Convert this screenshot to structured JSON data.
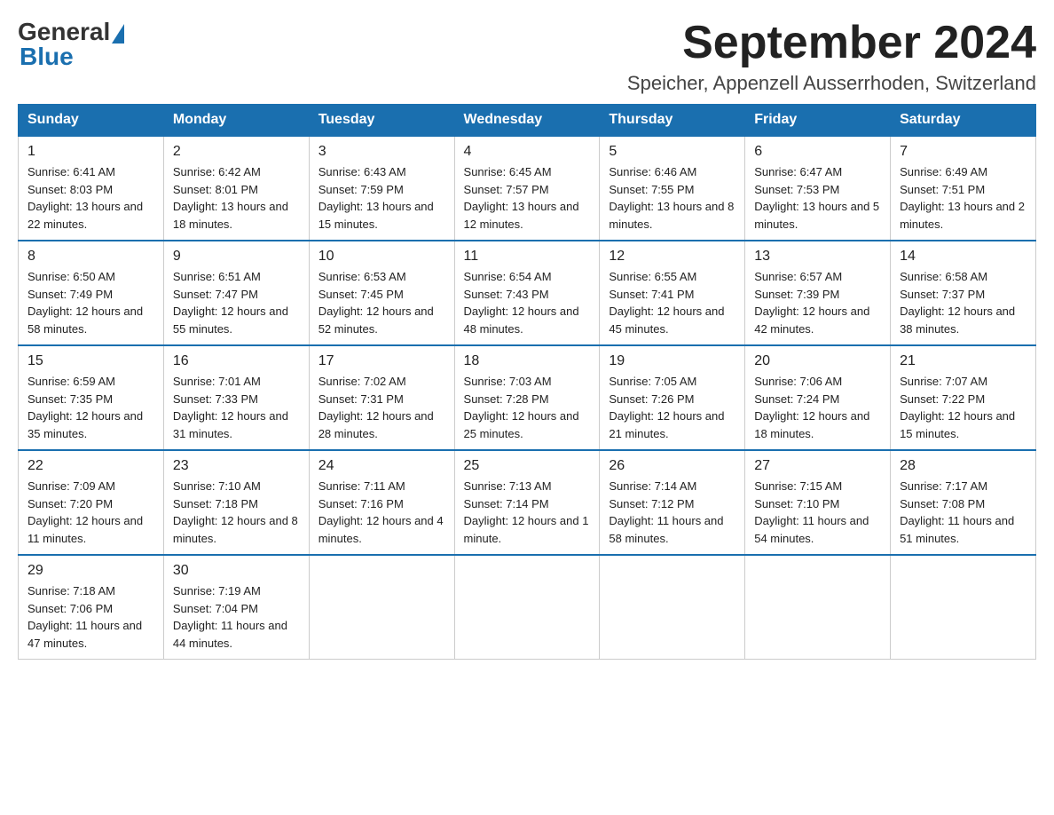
{
  "header": {
    "logo": {
      "general": "General",
      "blue": "Blue"
    },
    "title": "September 2024",
    "location": "Speicher, Appenzell Ausserrhoden, Switzerland"
  },
  "days_of_week": [
    "Sunday",
    "Monday",
    "Tuesday",
    "Wednesday",
    "Thursday",
    "Friday",
    "Saturday"
  ],
  "weeks": [
    [
      {
        "day": "1",
        "sunrise": "Sunrise: 6:41 AM",
        "sunset": "Sunset: 8:03 PM",
        "daylight": "Daylight: 13 hours and 22 minutes."
      },
      {
        "day": "2",
        "sunrise": "Sunrise: 6:42 AM",
        "sunset": "Sunset: 8:01 PM",
        "daylight": "Daylight: 13 hours and 18 minutes."
      },
      {
        "day": "3",
        "sunrise": "Sunrise: 6:43 AM",
        "sunset": "Sunset: 7:59 PM",
        "daylight": "Daylight: 13 hours and 15 minutes."
      },
      {
        "day": "4",
        "sunrise": "Sunrise: 6:45 AM",
        "sunset": "Sunset: 7:57 PM",
        "daylight": "Daylight: 13 hours and 12 minutes."
      },
      {
        "day": "5",
        "sunrise": "Sunrise: 6:46 AM",
        "sunset": "Sunset: 7:55 PM",
        "daylight": "Daylight: 13 hours and 8 minutes."
      },
      {
        "day": "6",
        "sunrise": "Sunrise: 6:47 AM",
        "sunset": "Sunset: 7:53 PM",
        "daylight": "Daylight: 13 hours and 5 minutes."
      },
      {
        "day": "7",
        "sunrise": "Sunrise: 6:49 AM",
        "sunset": "Sunset: 7:51 PM",
        "daylight": "Daylight: 13 hours and 2 minutes."
      }
    ],
    [
      {
        "day": "8",
        "sunrise": "Sunrise: 6:50 AM",
        "sunset": "Sunset: 7:49 PM",
        "daylight": "Daylight: 12 hours and 58 minutes."
      },
      {
        "day": "9",
        "sunrise": "Sunrise: 6:51 AM",
        "sunset": "Sunset: 7:47 PM",
        "daylight": "Daylight: 12 hours and 55 minutes."
      },
      {
        "day": "10",
        "sunrise": "Sunrise: 6:53 AM",
        "sunset": "Sunset: 7:45 PM",
        "daylight": "Daylight: 12 hours and 52 minutes."
      },
      {
        "day": "11",
        "sunrise": "Sunrise: 6:54 AM",
        "sunset": "Sunset: 7:43 PM",
        "daylight": "Daylight: 12 hours and 48 minutes."
      },
      {
        "day": "12",
        "sunrise": "Sunrise: 6:55 AM",
        "sunset": "Sunset: 7:41 PM",
        "daylight": "Daylight: 12 hours and 45 minutes."
      },
      {
        "day": "13",
        "sunrise": "Sunrise: 6:57 AM",
        "sunset": "Sunset: 7:39 PM",
        "daylight": "Daylight: 12 hours and 42 minutes."
      },
      {
        "day": "14",
        "sunrise": "Sunrise: 6:58 AM",
        "sunset": "Sunset: 7:37 PM",
        "daylight": "Daylight: 12 hours and 38 minutes."
      }
    ],
    [
      {
        "day": "15",
        "sunrise": "Sunrise: 6:59 AM",
        "sunset": "Sunset: 7:35 PM",
        "daylight": "Daylight: 12 hours and 35 minutes."
      },
      {
        "day": "16",
        "sunrise": "Sunrise: 7:01 AM",
        "sunset": "Sunset: 7:33 PM",
        "daylight": "Daylight: 12 hours and 31 minutes."
      },
      {
        "day": "17",
        "sunrise": "Sunrise: 7:02 AM",
        "sunset": "Sunset: 7:31 PM",
        "daylight": "Daylight: 12 hours and 28 minutes."
      },
      {
        "day": "18",
        "sunrise": "Sunrise: 7:03 AM",
        "sunset": "Sunset: 7:28 PM",
        "daylight": "Daylight: 12 hours and 25 minutes."
      },
      {
        "day": "19",
        "sunrise": "Sunrise: 7:05 AM",
        "sunset": "Sunset: 7:26 PM",
        "daylight": "Daylight: 12 hours and 21 minutes."
      },
      {
        "day": "20",
        "sunrise": "Sunrise: 7:06 AM",
        "sunset": "Sunset: 7:24 PM",
        "daylight": "Daylight: 12 hours and 18 minutes."
      },
      {
        "day": "21",
        "sunrise": "Sunrise: 7:07 AM",
        "sunset": "Sunset: 7:22 PM",
        "daylight": "Daylight: 12 hours and 15 minutes."
      }
    ],
    [
      {
        "day": "22",
        "sunrise": "Sunrise: 7:09 AM",
        "sunset": "Sunset: 7:20 PM",
        "daylight": "Daylight: 12 hours and 11 minutes."
      },
      {
        "day": "23",
        "sunrise": "Sunrise: 7:10 AM",
        "sunset": "Sunset: 7:18 PM",
        "daylight": "Daylight: 12 hours and 8 minutes."
      },
      {
        "day": "24",
        "sunrise": "Sunrise: 7:11 AM",
        "sunset": "Sunset: 7:16 PM",
        "daylight": "Daylight: 12 hours and 4 minutes."
      },
      {
        "day": "25",
        "sunrise": "Sunrise: 7:13 AM",
        "sunset": "Sunset: 7:14 PM",
        "daylight": "Daylight: 12 hours and 1 minute."
      },
      {
        "day": "26",
        "sunrise": "Sunrise: 7:14 AM",
        "sunset": "Sunset: 7:12 PM",
        "daylight": "Daylight: 11 hours and 58 minutes."
      },
      {
        "day": "27",
        "sunrise": "Sunrise: 7:15 AM",
        "sunset": "Sunset: 7:10 PM",
        "daylight": "Daylight: 11 hours and 54 minutes."
      },
      {
        "day": "28",
        "sunrise": "Sunrise: 7:17 AM",
        "sunset": "Sunset: 7:08 PM",
        "daylight": "Daylight: 11 hours and 51 minutes."
      }
    ],
    [
      {
        "day": "29",
        "sunrise": "Sunrise: 7:18 AM",
        "sunset": "Sunset: 7:06 PM",
        "daylight": "Daylight: 11 hours and 47 minutes."
      },
      {
        "day": "30",
        "sunrise": "Sunrise: 7:19 AM",
        "sunset": "Sunset: 7:04 PM",
        "daylight": "Daylight: 11 hours and 44 minutes."
      },
      null,
      null,
      null,
      null,
      null
    ]
  ]
}
